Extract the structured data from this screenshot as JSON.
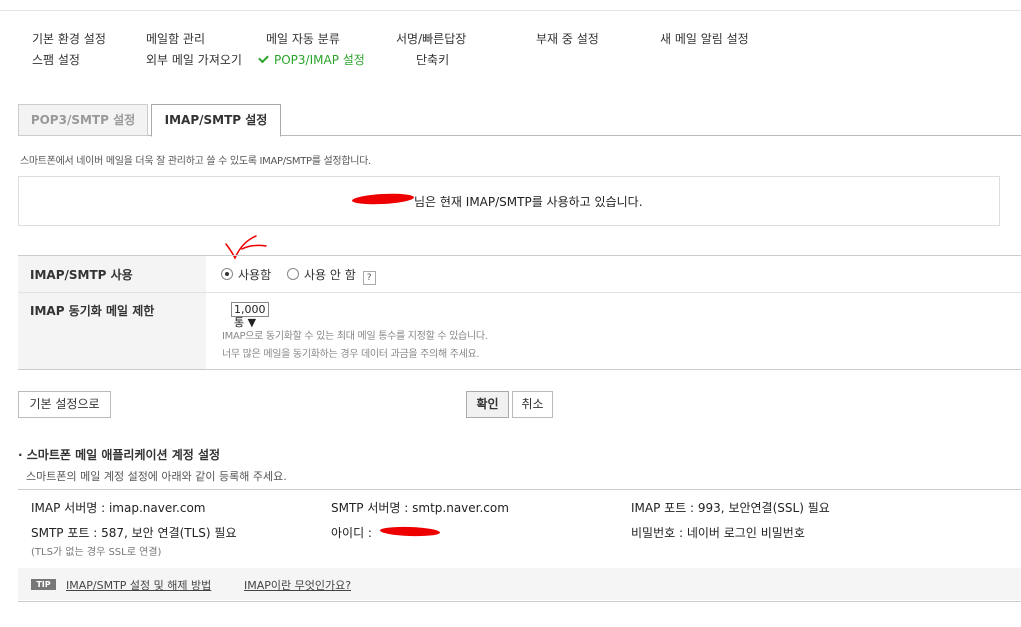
{
  "nav": {
    "row1": [
      "기본 환경 설정",
      "메일함 관리",
      "메일 자동 분류",
      "서명/빠른답장",
      "부재 중 설정",
      "새 메일 알림 설정"
    ],
    "row2": [
      "스팸 설정",
      "외부 메일 가져오기",
      "POP3/IMAP 설정",
      "단축키"
    ],
    "active": "POP3/IMAP 설정"
  },
  "tabs": [
    "POP3/SMTP 설정",
    "IMAP/SMTP 설정"
  ],
  "active_tab": "IMAP/SMTP 설정",
  "description": "스마트폰에서 네이버 메일을 더욱 잘 관리하고 쓸 수 있도록 IMAP/SMTP를 설정합니다.",
  "status_text": "님은 현재 IMAP/SMTP를 사용하고 있습니다.",
  "settings": {
    "imap_label": "IMAP/SMTP 사용",
    "opt_use": "사용함",
    "opt_nouse": "사용 안 함",
    "help": "?",
    "sync_label": "IMAP 동기화 메일 제한",
    "sync_value": "1,000통 ▼",
    "hint1": "IMAP으로 동기화할 수 있는 최대 메일 통수를 지정할 수 있습니다.",
    "hint2": "너무 많은 메일을 동기화하는 경우 데이터 과금을 주의해 주세요."
  },
  "buttons": {
    "reset": "기본 설정으로",
    "ok": "확인",
    "cancel": "취소"
  },
  "section": {
    "title": "스마트폰 메일 애플리케이션 계정 설정",
    "subtitle": "스마트폰의 메일 계정 설정에 아래와 같이 등록해 주세요.",
    "imap_server": "IMAP 서버명 : imap.naver.com",
    "smtp_server": "SMTP 서버명 : smtp.naver.com",
    "imap_port": "IMAP 포트 : 993, 보안연결(SSL) 필요",
    "smtp_port": "SMTP 포트 : 587, 보안 연결(TLS) 필요",
    "tls_note": "(TLS가 없는 경우 SSL로 연결)",
    "id": "아이디 :",
    "password": "비밀번호 : 네이버 로그인 비밀번호"
  },
  "tip": {
    "badge": "TIP",
    "link1": "IMAP/SMTP 설정 및 해제 방법",
    "link2": "IMAP이란 무엇인가요?"
  }
}
